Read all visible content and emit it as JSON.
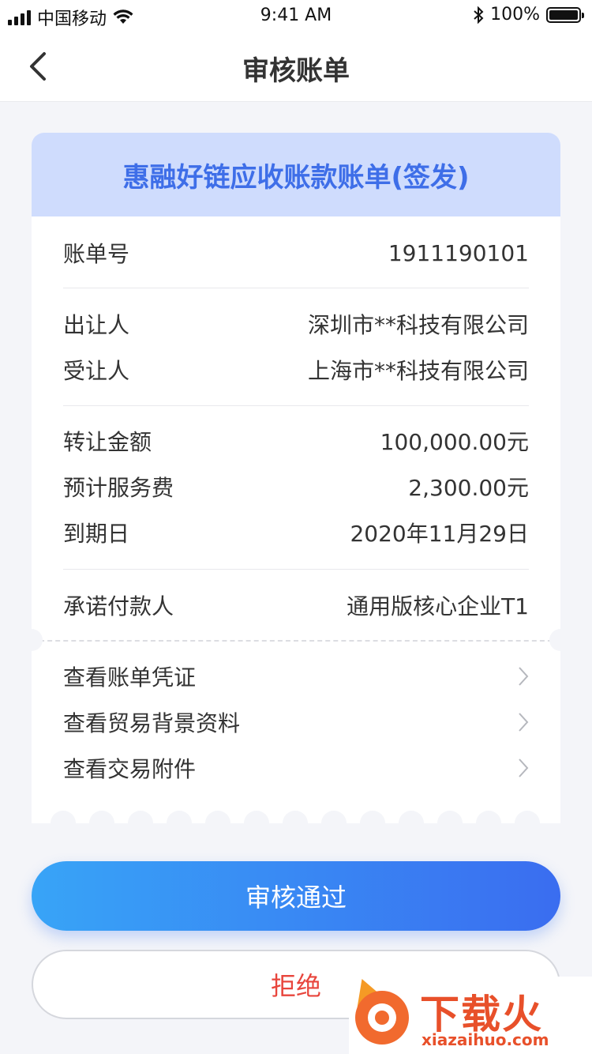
{
  "status_bar": {
    "carrier": "中国移动",
    "time": "9:41 AM",
    "battery": "100%"
  },
  "nav": {
    "title": "审核账单"
  },
  "bill": {
    "title": "惠融好链应收账款账单(签发)",
    "rows": [
      {
        "label": "账单号",
        "value": "1911190101"
      },
      {
        "label": "出让人",
        "value": "深圳市**科技有限公司"
      },
      {
        "label": "受让人",
        "value": "上海市**科技有限公司"
      },
      {
        "label": "转让金额",
        "value": "100,000.00元"
      },
      {
        "label": "预计服务费",
        "value": "2,300.00元"
      },
      {
        "label": "到期日",
        "value": "2020年11月29日"
      },
      {
        "label": "承诺付款人",
        "value": "通用版核心企业T1"
      }
    ],
    "links": [
      {
        "label": "查看账单凭证"
      },
      {
        "label": "查看贸易背景资料"
      },
      {
        "label": "查看交易附件"
      }
    ]
  },
  "actions": {
    "approve_label": "审核通过",
    "reject_label": "拒绝"
  },
  "watermark": {
    "brand": "下载火",
    "domain": "xiazaihuo.com"
  },
  "colors": {
    "primary_start": "#38a4f7",
    "primary_end": "#3a6df0",
    "header_bg": "#cfdcfd",
    "header_text": "#3e6ee8",
    "reject_text": "#e8453c"
  }
}
